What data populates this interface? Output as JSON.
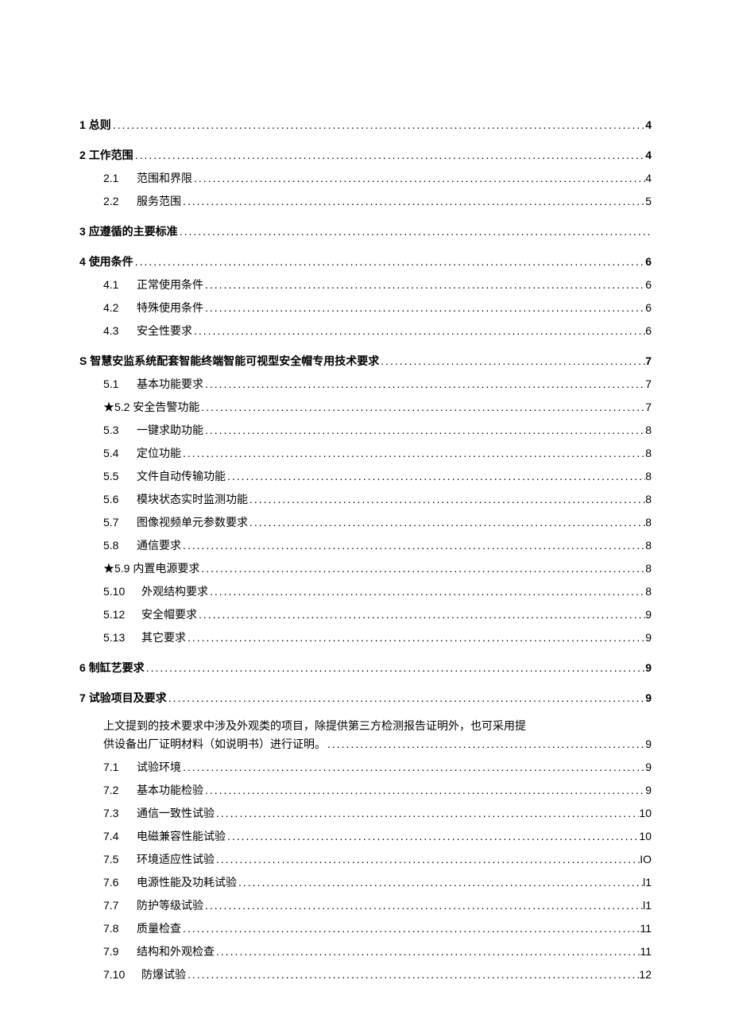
{
  "toc": {
    "s1": {
      "num": "1",
      "title": "总则",
      "page": "4"
    },
    "s2": {
      "num": "2",
      "title": "工作范围",
      "page": "4"
    },
    "s2_1": {
      "num": "2.1",
      "title": "范围和界限",
      "page": "4"
    },
    "s2_2": {
      "num": "2.2",
      "title": "服务范围",
      "page": "5"
    },
    "s3": {
      "num": "3",
      "title": "应遵循的主要标准",
      "page": ""
    },
    "s4": {
      "num": "4",
      "title": "使用条件",
      "page": "6"
    },
    "s4_1": {
      "num": "4.1",
      "title": "正常使用条件",
      "page": "6"
    },
    "s4_2": {
      "num": "4.2",
      "title": "特殊使用条件",
      "page": "6"
    },
    "s4_3": {
      "num": "4.3",
      "title": "安全性要求",
      "page": "6"
    },
    "s5": {
      "num": "S",
      "title": "智慧安监系统配套智能终端智能可视型安全帽专用技术要求",
      "page": "7"
    },
    "s5_1": {
      "num": "5.1",
      "title": "基本功能要求",
      "page": "7"
    },
    "s5_2": {
      "num": "★5.2",
      "title": "安全告警功能",
      "page": "7"
    },
    "s5_3": {
      "num": "5.3",
      "title": "一键求助功能",
      "page": "8"
    },
    "s5_4": {
      "num": "5.4",
      "title": "定位功能",
      "page": "8"
    },
    "s5_5": {
      "num": "5.5",
      "title": "文件自动传输功能",
      "page": "8"
    },
    "s5_6": {
      "num": "5.6",
      "title": "模块状态实时监测功能",
      "page": "8"
    },
    "s5_7": {
      "num": "5.7",
      "title": "图像视频单元参数要求",
      "page": "8"
    },
    "s5_8": {
      "num": "5.8",
      "title": "通信要求",
      "page": "8"
    },
    "s5_9": {
      "num": "★5.9",
      "title": "内置电源要求",
      "page": "8"
    },
    "s5_10": {
      "num": "5.10",
      "title": "外观结构要求",
      "page": "8"
    },
    "s5_12": {
      "num": "5.12",
      "title": "安全帽要求",
      "page": "9"
    },
    "s5_13": {
      "num": "5.13",
      "title": "其它要求",
      "page": "9"
    },
    "s6": {
      "num": "6",
      "title": "制缸艺要求",
      "page": "9"
    },
    "s7": {
      "num": "7",
      "title": "试验项目及要求",
      "page": "9"
    },
    "s7_note_l1": "上文提到的技术要求中涉及外观类的项目，除提供第三方检测报告证明外，也可采用提",
    "s7_note_l2": "供设备出厂证明材料（如说明书）进行证明。",
    "s7_note_page": "9",
    "s7_1": {
      "num": "7.1",
      "title": "试验环境",
      "page": "9"
    },
    "s7_2": {
      "num": "7.2",
      "title": "基本功能检验",
      "page": "9"
    },
    "s7_3": {
      "num": "7.3",
      "title": "通信一致性试验",
      "page": "10"
    },
    "s7_4": {
      "num": "7.4",
      "title": "电磁兼容性能试验",
      "page": "10"
    },
    "s7_5": {
      "num": "7.5",
      "title": "环境适应性试验",
      "page": "IO"
    },
    "s7_6": {
      "num": "7.6",
      "title": "电源性能及功耗试验",
      "page": "l1"
    },
    "s7_7": {
      "num": "7.7",
      "title": "防护等级试验",
      "page": "l1"
    },
    "s7_8": {
      "num": "7.8",
      "title": "质量检查",
      "page": "11"
    },
    "s7_9": {
      "num": "7.9",
      "title": "结构和外观检查",
      "page": "11"
    },
    "s7_10": {
      "num": "7.10",
      "title": "防爆试验",
      "page": "12"
    }
  }
}
